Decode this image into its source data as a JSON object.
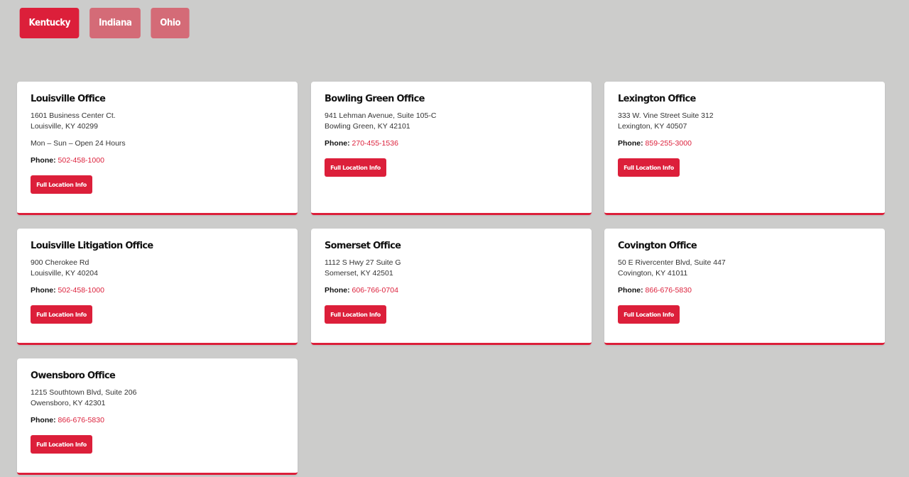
{
  "tabs": [
    {
      "label": "Kentucky",
      "active": true
    },
    {
      "label": "Indiana",
      "active": false
    },
    {
      "label": "Ohio",
      "active": false
    }
  ],
  "colors": {
    "accent": "#dc1f3a",
    "tab_inactive": "#d46b77",
    "background": "#cccccb"
  },
  "phone_label": "Phone:",
  "button_label": "Full Location Info",
  "offices": [
    {
      "title": "Louisville Office",
      "address_line1": "1601 Business Center Ct.",
      "address_line2": "Louisville, KY 40299",
      "hours": "Mon – Sun – Open 24 Hours",
      "phone": "502-458-1000"
    },
    {
      "title": "Bowling Green Office",
      "address_line1": "941 Lehman Avenue, Suite 105-C",
      "address_line2": "Bowling Green, KY 42101",
      "phone": "270-455-1536"
    },
    {
      "title": "Lexington Office",
      "address_line1": "333 W. Vine Street Suite 312",
      "address_line2": "Lexington, KY 40507",
      "phone": "859-255-3000"
    },
    {
      "title": "Louisville Litigation Office",
      "address_line1": "900 Cherokee Rd",
      "address_line2": "Louisville, KY 40204",
      "phone": "502-458-1000"
    },
    {
      "title": "Somerset Office",
      "address_line1": "1112 S Hwy 27 Suite G",
      "address_line2": "Somerset, KY 42501",
      "phone": "606-766-0704"
    },
    {
      "title": "Covington Office",
      "address_line1": "50 E Rivercenter Blvd, Suite 447",
      "address_line2": "Covington, KY 41011",
      "phone": "866-676-5830"
    },
    {
      "title": "Owensboro Office",
      "address_line1": "1215 Southtown Blvd, Suite 206",
      "address_line2": "Owensboro, KY 42301",
      "phone": "866-676-5830"
    }
  ]
}
